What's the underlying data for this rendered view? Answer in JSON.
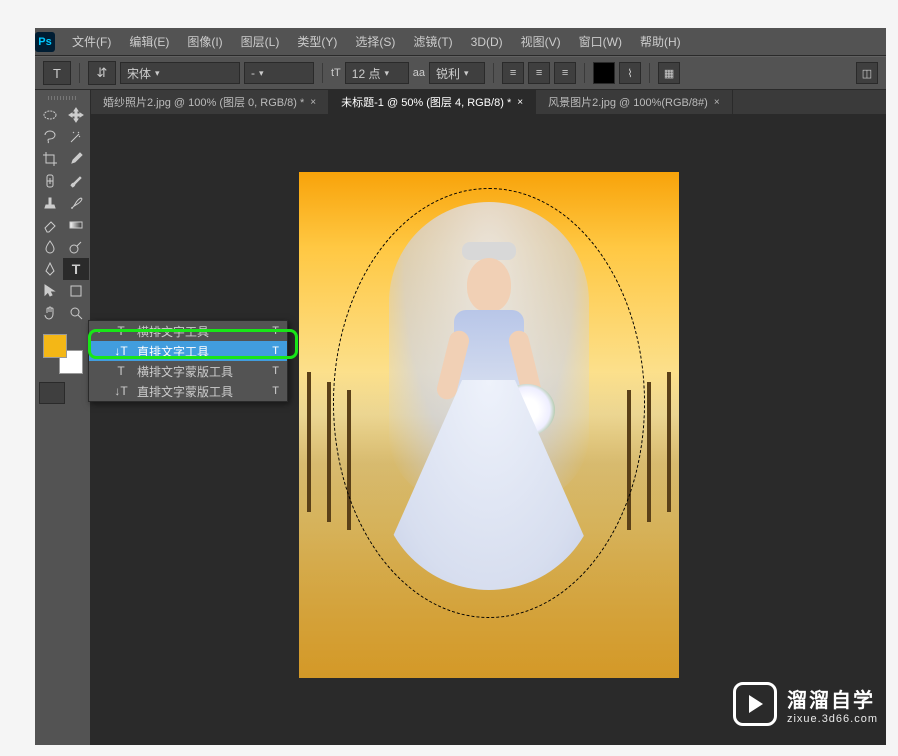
{
  "app": {
    "logo": "Ps"
  },
  "menu": {
    "items": [
      "文件(F)",
      "编辑(E)",
      "图像(I)",
      "图层(L)",
      "类型(Y)",
      "选择(S)",
      "滤镜(T)",
      "3D(D)",
      "视图(V)",
      "窗口(W)",
      "帮助(H)"
    ]
  },
  "options": {
    "type_icon": "T",
    "orient_icon": "⇵",
    "font_family": "宋体",
    "font_style": "-",
    "size_icon": "tT",
    "font_size": "12 点",
    "aa_icon": "aa",
    "aa_mode": "锐利"
  },
  "tabs": [
    {
      "label": "婚纱照片2.jpg @ 100% (图层 0, RGB/8) *",
      "active": false
    },
    {
      "label": "未标题-1 @ 50% (图层 4, RGB/8) *",
      "active": true
    },
    {
      "label": "风景图片2.jpg @ 100%(RGB/8#)",
      "active": false
    }
  ],
  "type_flyout": {
    "items": [
      {
        "icon": "T",
        "label": "横排文字工具",
        "key": "T"
      },
      {
        "icon": "↓T",
        "label": "直排文字工具",
        "key": "T"
      },
      {
        "icon": "T",
        "label": "横排文字蒙版工具",
        "key": "T"
      },
      {
        "icon": "↓T",
        "label": "直排文字蒙版工具",
        "key": "T"
      }
    ],
    "selected_index": 1
  },
  "watermark": {
    "title": "溜溜自学",
    "sub": "zixue.3d66.com"
  }
}
